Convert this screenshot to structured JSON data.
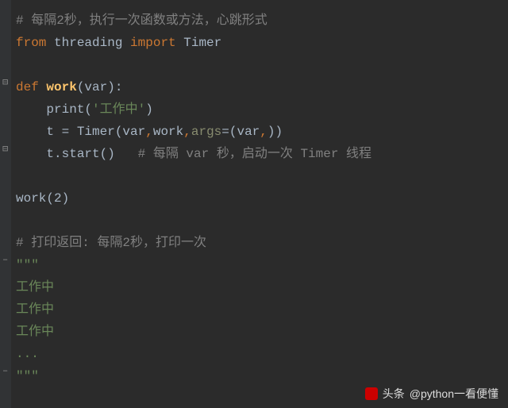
{
  "code": {
    "l1_comment": "# 每隔2秒，执行一次函数或方法，心跳形式",
    "l2_from": "from ",
    "l2_mod": "threading ",
    "l2_import": "import ",
    "l2_name": "Timer",
    "l4_def": "def ",
    "l4_fname": "work",
    "l4_paren_open": "(",
    "l4_var": "var",
    "l4_paren_close": "):",
    "l5_indent": "    ",
    "l5_print": "print(",
    "l5_str": "'工作中'",
    "l5_close": ")",
    "l6_indent": "    ",
    "l6_assign": "t = Timer(var",
    "l6_comma1": ",",
    "l6_work": "work",
    "l6_comma2": ",",
    "l6_args": "args",
    "l6_eq": "=(var",
    "l6_comma3": ",",
    "l6_close": "))",
    "l7_indent": "    ",
    "l7_call": "t.start()   ",
    "l7_comment": "# 每隔 var 秒，启动一次 Timer 线程",
    "l9": "work(",
    "l9_arg": "2",
    "l9_close": ")",
    "l11_comment": "# 打印返回: 每隔2秒，打印一次",
    "l12": "\"\"\"",
    "l13": "工作中",
    "l14": "工作中",
    "l15": "工作中",
    "l16": "...",
    "l17": "\"\"\""
  },
  "watermark": "@python一看便懂",
  "watermark_prefix": "头条"
}
